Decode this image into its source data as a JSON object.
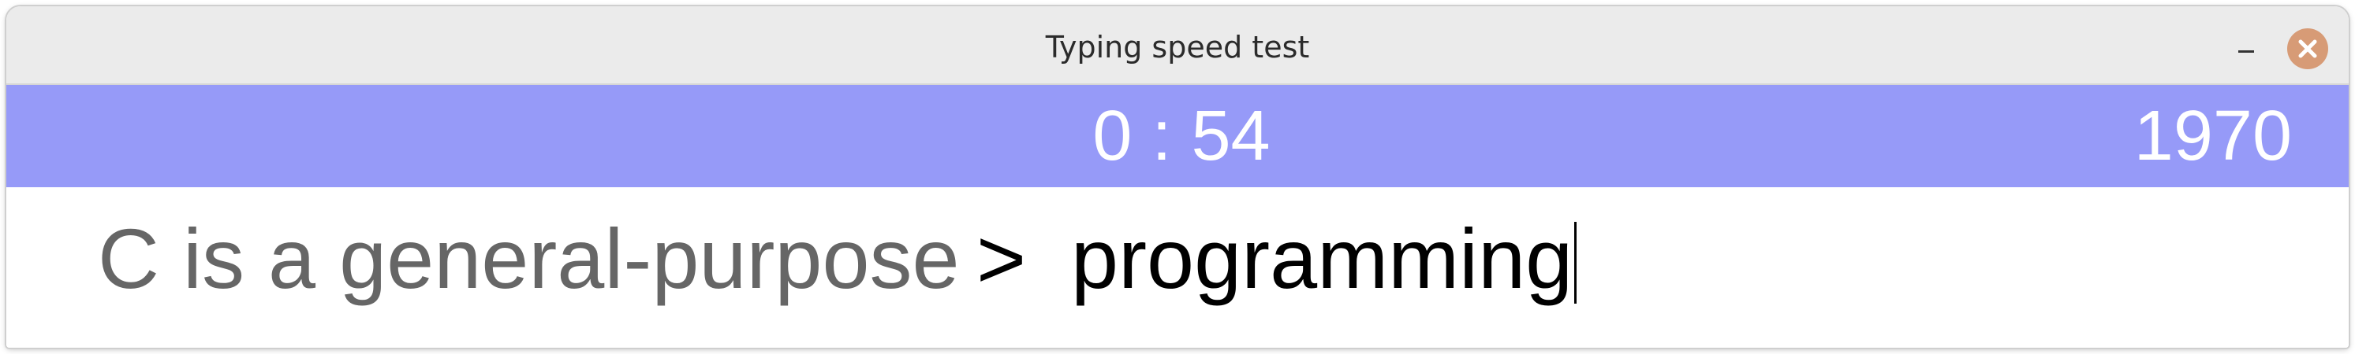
{
  "window": {
    "title": "Typing speed test"
  },
  "titlebar_buttons": {
    "minimize_icon": "minimize-icon",
    "close_icon": "close-icon",
    "close_color": "#d79b76"
  },
  "header": {
    "timer": "0 : 54",
    "score": "1970",
    "background_color": "#969af8"
  },
  "typing": {
    "completed_text": "C is a general-purpose",
    "prompt_symbol": ">",
    "current_word": "programming"
  }
}
